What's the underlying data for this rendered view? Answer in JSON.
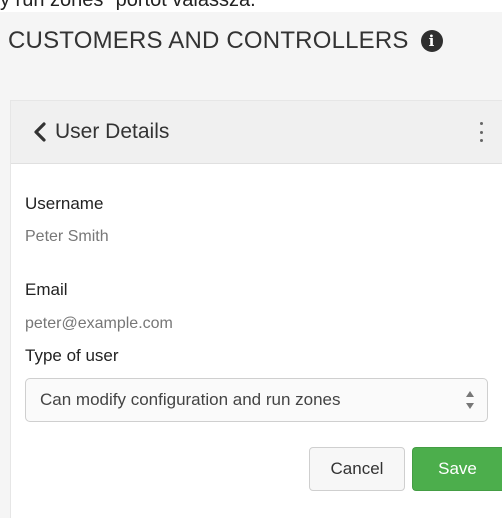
{
  "doc_fragment": "y run zones” portot válassza.",
  "section": {
    "title": "CUSTOMERS AND CONTROLLERS",
    "info_icon": "info-circle-icon"
  },
  "panel": {
    "title": "User Details",
    "back_icon": "chevron-left-icon",
    "menu_icon": "kebab-menu-icon",
    "fields": {
      "username_label": "Username",
      "username_value": "Peter Smith",
      "email_label": "Email",
      "email_value": "peter@example.com",
      "type_label": "Type of user",
      "type_selected": "Can modify configuration and run zones"
    },
    "buttons": {
      "cancel": "Cancel",
      "save": "Save"
    }
  },
  "colors": {
    "save_green": "#4cae4c",
    "header_bg": "#f0f0f0",
    "page_bg": "#f5f5f5"
  }
}
